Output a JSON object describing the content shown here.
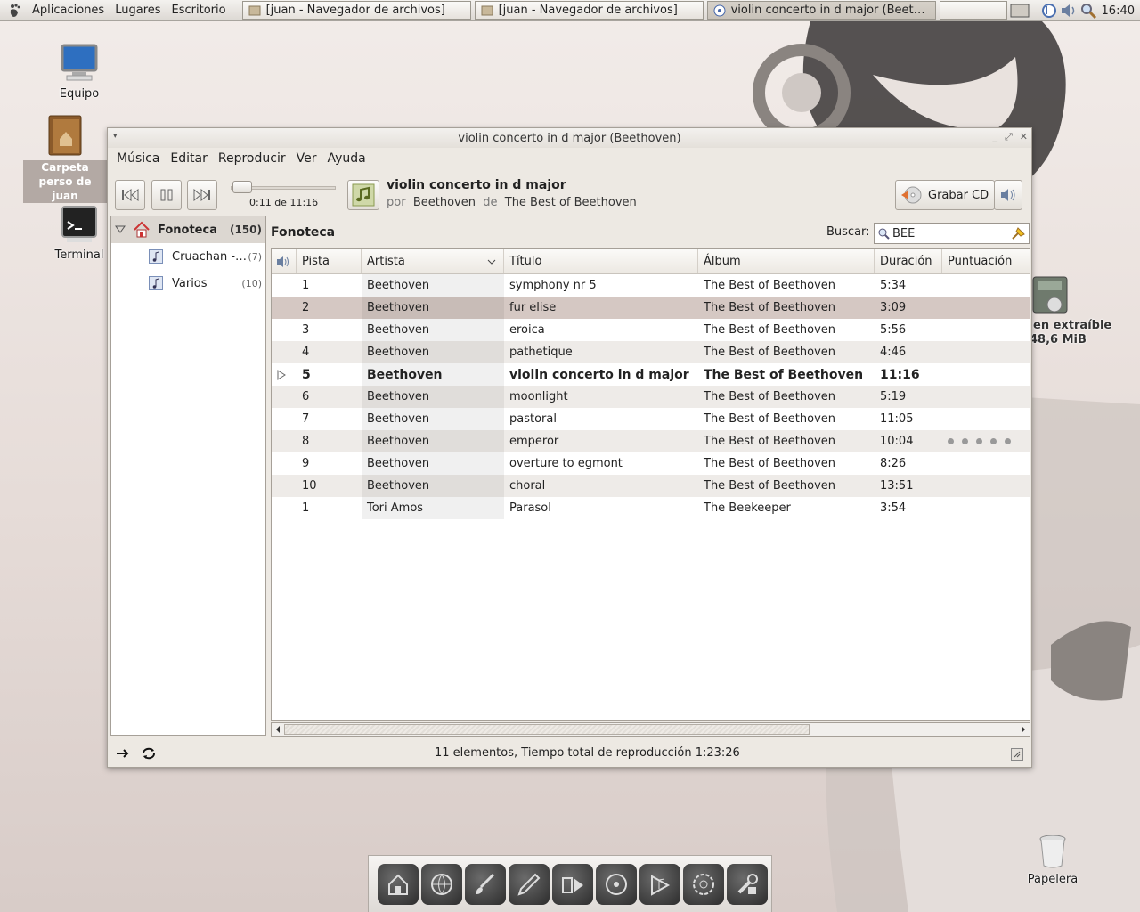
{
  "top_panel": {
    "menus": [
      "Aplicaciones",
      "Lugares",
      "Escritorio"
    ],
    "tasks": [
      {
        "label": "[juan - Navegador de archivos]",
        "active": false
      },
      {
        "label": "[juan - Navegador de archivos]",
        "active": false
      },
      {
        "label": "violin concerto in d major (Beeth…",
        "active": true
      }
    ],
    "clock": "16:40"
  },
  "desktop": {
    "icons": [
      {
        "label": "Equipo"
      },
      {
        "label": "Carpeta perso de juan"
      },
      {
        "label": "Terminal"
      },
      {
        "label_line1": "en extraíble",
        "label_line2": "48,6 MiB"
      },
      {
        "label": "Papelera"
      }
    ]
  },
  "window": {
    "title": "violin concerto in d major (Beethoven)",
    "menu": [
      "Música",
      "Editar",
      "Reproducir",
      "Ver",
      "Ayuda"
    ],
    "player": {
      "position": "0:11 de 11:16",
      "progress": 0.016,
      "track_title": "violin concerto in d major",
      "by_label": "por",
      "artist": "Beethoven",
      "from_label": "de",
      "album": "The Best of Beethoven",
      "burn_label": "Grabar CD"
    },
    "sidebar": {
      "library": {
        "label": "Fonoteca",
        "count": "(150)"
      },
      "playlists": [
        {
          "label": "Cruachan -…",
          "count": "(7)"
        },
        {
          "label": "Varios",
          "count": "(10)"
        }
      ]
    },
    "content": {
      "heading": "Fonoteca",
      "search_label": "Buscar:",
      "search_value": "BEE",
      "columns": [
        "Pista",
        "Artista",
        "Título",
        "Álbum",
        "Duración",
        "Puntuación"
      ],
      "rows": [
        {
          "track": "1",
          "artist": "Beethoven",
          "title": "symphony nr 5",
          "album": "The Best of Beethoven",
          "duration": "5:34",
          "rating": 0
        },
        {
          "track": "2",
          "artist": "Beethoven",
          "title": "fur elise",
          "album": "The Best of Beethoven",
          "duration": "3:09",
          "rating": 0
        },
        {
          "track": "3",
          "artist": "Beethoven",
          "title": "eroica",
          "album": "The Best of Beethoven",
          "duration": "5:56",
          "rating": 0
        },
        {
          "track": "4",
          "artist": "Beethoven",
          "title": "pathetique",
          "album": "The Best of Beethoven",
          "duration": "4:46",
          "rating": 0
        },
        {
          "track": "5",
          "artist": "Beethoven",
          "title": "violin concerto in d major",
          "album": "The Best of Beethoven",
          "duration": "11:16",
          "rating": 0
        },
        {
          "track": "6",
          "artist": "Beethoven",
          "title": "moonlight",
          "album": "The Best of Beethoven",
          "duration": "5:19",
          "rating": 0
        },
        {
          "track": "7",
          "artist": "Beethoven",
          "title": "pastoral",
          "album": "The Best of Beethoven",
          "duration": "11:05",
          "rating": 0
        },
        {
          "track": "8",
          "artist": "Beethoven",
          "title": "emperor",
          "album": "The Best of Beethoven",
          "duration": "10:04",
          "rating": 0
        },
        {
          "track": "9",
          "artist": "Beethoven",
          "title": "overture to egmont",
          "album": "The Best of Beethoven",
          "duration": "8:26",
          "rating": 0
        },
        {
          "track": "10",
          "artist": "Beethoven",
          "title": "choral",
          "album": "The Best of Beethoven",
          "duration": "13:51",
          "rating": 0
        },
        {
          "track": "1",
          "artist": "Tori Amos",
          "title": "Parasol",
          "album": "The Beekeeper",
          "duration": "3:54",
          "rating": 0
        }
      ],
      "selected_row": 1,
      "playing_row": 4,
      "hover_rating_row": 7
    },
    "status": "11 elementos, Tiempo total de reproducción 1:23:26"
  },
  "dock": {
    "icons": [
      "home-icon",
      "globe-icon",
      "paint-icon",
      "pen-icon",
      "video-icon",
      "disc-icon",
      "music-icon",
      "cd-burn-icon",
      "tools-icon"
    ]
  },
  "colors": {
    "selection": "#d5c8c3",
    "library_bg": "#dcd7d1",
    "window_bg": "#ede9e3"
  }
}
